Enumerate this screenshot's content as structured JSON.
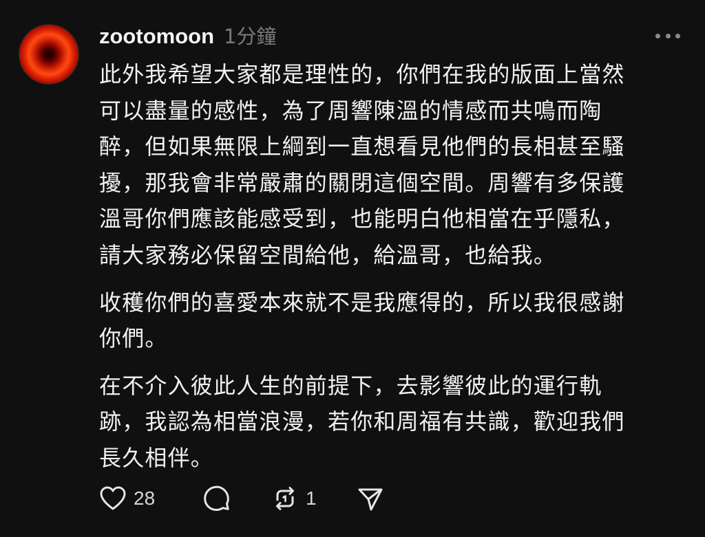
{
  "post": {
    "username": "zootomoon",
    "timestamp": "1分鐘",
    "paragraphs": [
      "此外我希望大家都是理性的，你們在我的版面上當然\n可以盡量的感性，為了周響陳溫的情感而共鳴而陶\n醉，但如果無限上綱到一直想看見他們的長相甚至騷\n擾，那我會非常嚴肅的關閉這個空間。周響有多保護\n溫哥你們應該能感受到，也能明白他相當在乎隱私，\n請大家務必保留空間給他，給溫哥，也給我。",
      "收穫你們的喜愛本來就不是我應得的，所以我很感謝\n你們。",
      "在不介入彼此人生的前提下，去影響彼此的運行軌\n跡，我認為相當浪漫，若你和周福有共識，歡迎我們\n長久相伴。"
    ],
    "actions": {
      "like_count": "28",
      "repost_count": "1"
    }
  },
  "icons": {
    "like": "heart-icon",
    "reply": "comment-bubble-icon",
    "repost": "repost-icon",
    "share": "send-icon",
    "more": "more-dots-icon"
  },
  "colors": {
    "background": "#101010",
    "text": "#f1f1f1",
    "muted": "#7a7a7a"
  }
}
